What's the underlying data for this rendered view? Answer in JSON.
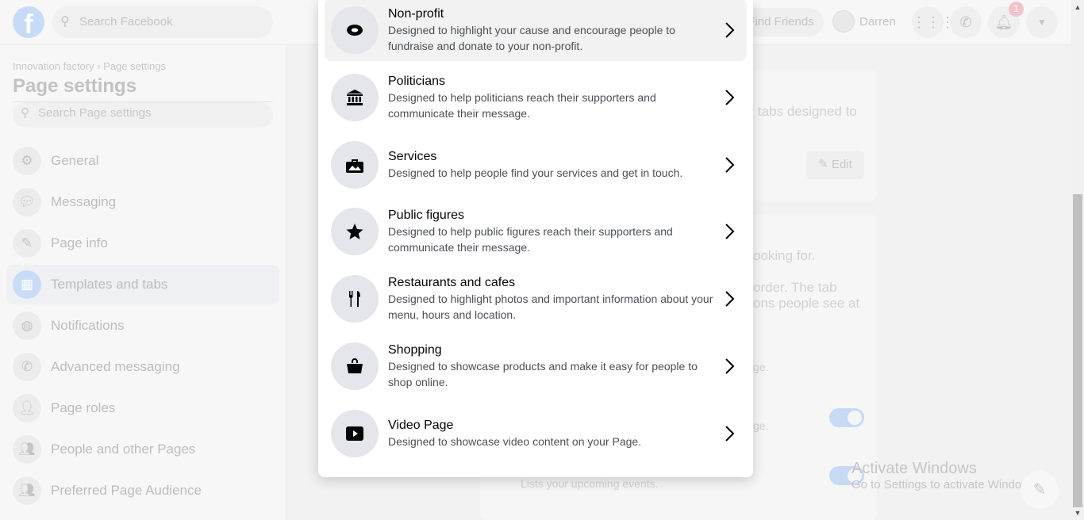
{
  "topbar": {
    "search_placeholder": "Search Facebook",
    "find_friends": "Find Friends",
    "user_name": "Darren",
    "notification_count": "1"
  },
  "sidebar": {
    "breadcrumb": "Innovation factory › Page settings",
    "title": "Page settings",
    "search_placeholder": "Search Page settings",
    "items": [
      {
        "label": "General",
        "icon": "gear-icon"
      },
      {
        "label": "Messaging",
        "icon": "chat-icon"
      },
      {
        "label": "Page info",
        "icon": "pencil-icon"
      },
      {
        "label": "Templates and tabs",
        "icon": "grid-icon",
        "active": true
      },
      {
        "label": "Notifications",
        "icon": "globe-icon"
      },
      {
        "label": "Advanced messaging",
        "icon": "messenger-icon"
      },
      {
        "label": "Page roles",
        "icon": "person-icon"
      },
      {
        "label": "People and other Pages",
        "icon": "people-icon"
      },
      {
        "label": "Preferred Page Audience",
        "icon": "people-icon"
      }
    ]
  },
  "background": {
    "text1": "tabs designed to",
    "edit_label": "Edit",
    "text2": "ooking for.",
    "text3": "order. The tab",
    "text4": "ons people see at",
    "text5": "ge.",
    "text6": "ge.",
    "text7": "Lists your upcoming events."
  },
  "watermark": {
    "title": "Activate Windows",
    "subtitle": "Go to Settings to activate Windows."
  },
  "templates": [
    {
      "title": "Non-profit",
      "desc": "Designed to highlight your cause and encourage people to fundraise and donate to your non-profit.",
      "icon": "donation-icon"
    },
    {
      "title": "Politicians",
      "desc": "Designed to help politicians reach their supporters and communicate their message.",
      "icon": "government-building-icon"
    },
    {
      "title": "Services",
      "desc": "Designed to help people find your services and get in touch.",
      "icon": "briefcase-icon"
    },
    {
      "title": "Public figures",
      "desc": "Designed to help public figures reach their supporters and communicate their message.",
      "icon": "star-icon"
    },
    {
      "title": "Restaurants and cafes",
      "desc": "Designed to highlight photos and important information about your menu, hours and location.",
      "icon": "fork-knife-icon"
    },
    {
      "title": "Shopping",
      "desc": "Designed to showcase products and make it easy for people to shop online.",
      "icon": "shopping-bag-icon"
    },
    {
      "title": "Video Page",
      "desc": "Designed to showcase video content on your Page.",
      "icon": "video-play-icon"
    }
  ],
  "colors": {
    "accent": "#1877f2",
    "modal_bg": "#ffffff",
    "icon_circle": "#e4e6eb"
  }
}
